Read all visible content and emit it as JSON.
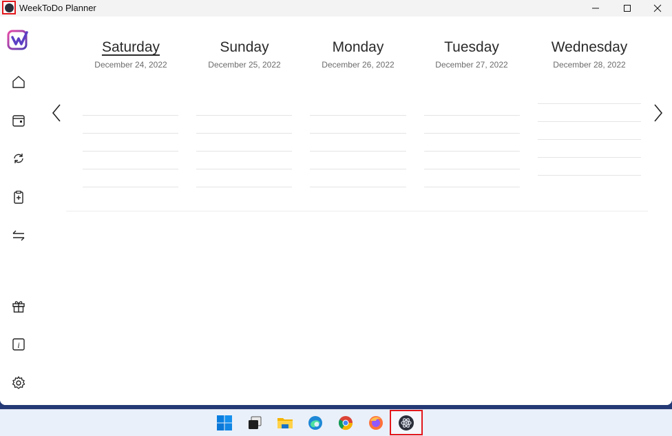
{
  "window": {
    "title": "WeekToDo Planner"
  },
  "sidebar": {
    "items": [
      {
        "icon": "home-icon"
      },
      {
        "icon": "calendar-icon"
      },
      {
        "icon": "sync-icon"
      },
      {
        "icon": "clipboard-add-icon"
      },
      {
        "icon": "arrows-swap-icon"
      },
      {
        "icon": "gift-icon"
      },
      {
        "icon": "info-icon"
      },
      {
        "icon": "gear-icon"
      }
    ]
  },
  "days": [
    {
      "name": "Saturday",
      "date": "December 24, 2022",
      "today": true
    },
    {
      "name": "Sunday",
      "date": "December 25, 2022"
    },
    {
      "name": "Monday",
      "date": "December 26, 2022"
    },
    {
      "name": "Tuesday",
      "date": "December 27, 2022"
    },
    {
      "name": "Wednesday",
      "date": "December 28, 2022"
    }
  ],
  "taskbar": {
    "apps": [
      "windows-start-icon",
      "task-view-icon",
      "file-explorer-icon",
      "edge-icon",
      "chrome-icon",
      "firefox-icon",
      "weektodo-taskbar-icon"
    ]
  },
  "colors": {
    "accent": "#6f42c1",
    "highlight": "#e2161b"
  }
}
